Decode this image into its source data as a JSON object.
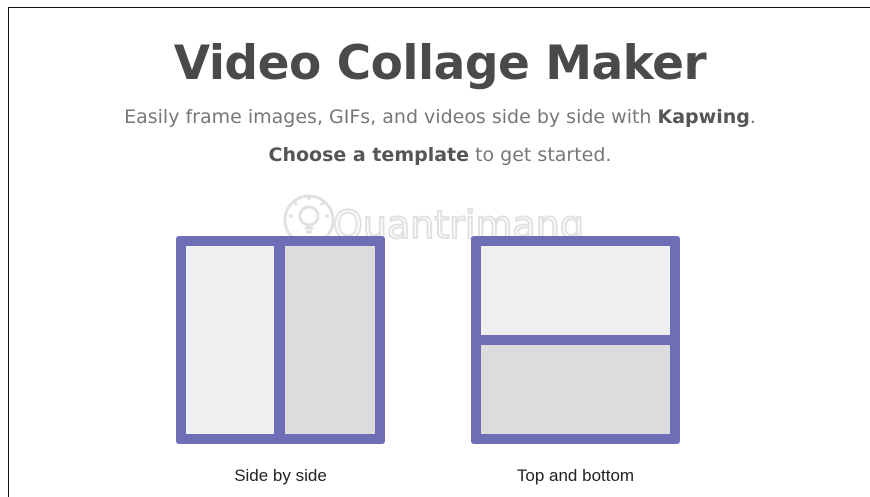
{
  "header": {
    "title": "Video Collage Maker",
    "subtitle_prefix": "Easily frame images, GIFs, and videos side by side with ",
    "subtitle_brand": "Kapwing",
    "subtitle_suffix": ".",
    "cta_bold": "Choose a template",
    "cta_rest": " to get started."
  },
  "watermark": {
    "text": "Quantrimang"
  },
  "templates": [
    {
      "label": "Side by side"
    },
    {
      "label": "Top and bottom"
    }
  ],
  "colors": {
    "accent": "#6e6db5",
    "pane_light": "#efefef",
    "pane_dark": "#dcdcdc",
    "title": "#4a4a4a",
    "text_muted": "#777777"
  }
}
